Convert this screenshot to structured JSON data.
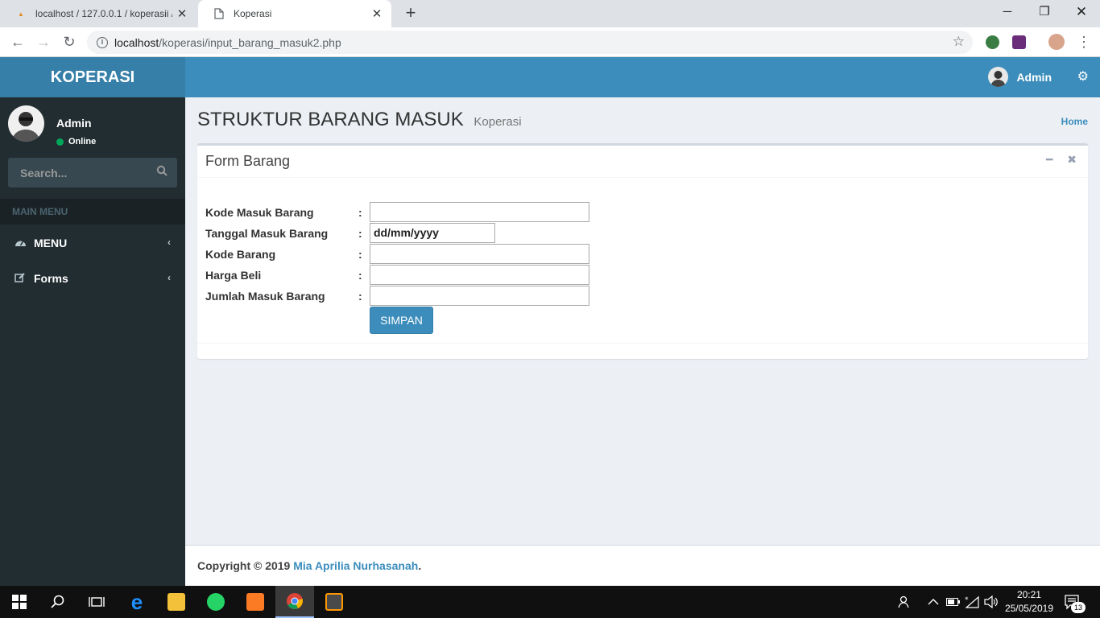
{
  "browser": {
    "tabs": [
      {
        "title": "localhost / 127.0.0.1 / koperasii /",
        "favicon": "PMA"
      },
      {
        "title": "Koperasi"
      }
    ],
    "url_host": "localhost",
    "url_path": "/koperasi/input_barang_masuk2.php"
  },
  "app": {
    "logo": "KOPERASI",
    "header_user": "Admin"
  },
  "sidebar": {
    "user_name": "Admin",
    "status": "Online",
    "search_placeholder": "Search...",
    "menu_header": "MAIN MENU",
    "items": [
      {
        "label": "MENU",
        "icon": "dashboard-icon"
      },
      {
        "label": "Forms",
        "icon": "edit-icon"
      }
    ]
  },
  "page": {
    "title": "STRUKTUR BARANG MASUK",
    "subtitle": "Koperasi",
    "breadcrumb": "Home"
  },
  "form": {
    "box_title": "Form Barang",
    "fields": [
      {
        "label": "Kode Masuk Barang",
        "value": ""
      },
      {
        "label": "Tanggal Masuk Barang",
        "value": "dd/mm/yyyy"
      },
      {
        "label": "Kode Barang",
        "value": ""
      },
      {
        "label": "Harga Beli",
        "value": ""
      },
      {
        "label": "Jumlah Masuk Barang",
        "value": ""
      }
    ],
    "colon": ":",
    "submit_label": "SIMPAN"
  },
  "footer": {
    "prefix": "Copyright © 2019 ",
    "author": "Mia Aprilia Nurhasanah",
    "suffix": "."
  },
  "taskbar": {
    "time": "20:21",
    "date": "25/05/2019",
    "notification_count": "13"
  },
  "colors": {
    "header": "#3c8dbc",
    "logo_bg": "#367fa9",
    "sidebar": "#222d32"
  }
}
